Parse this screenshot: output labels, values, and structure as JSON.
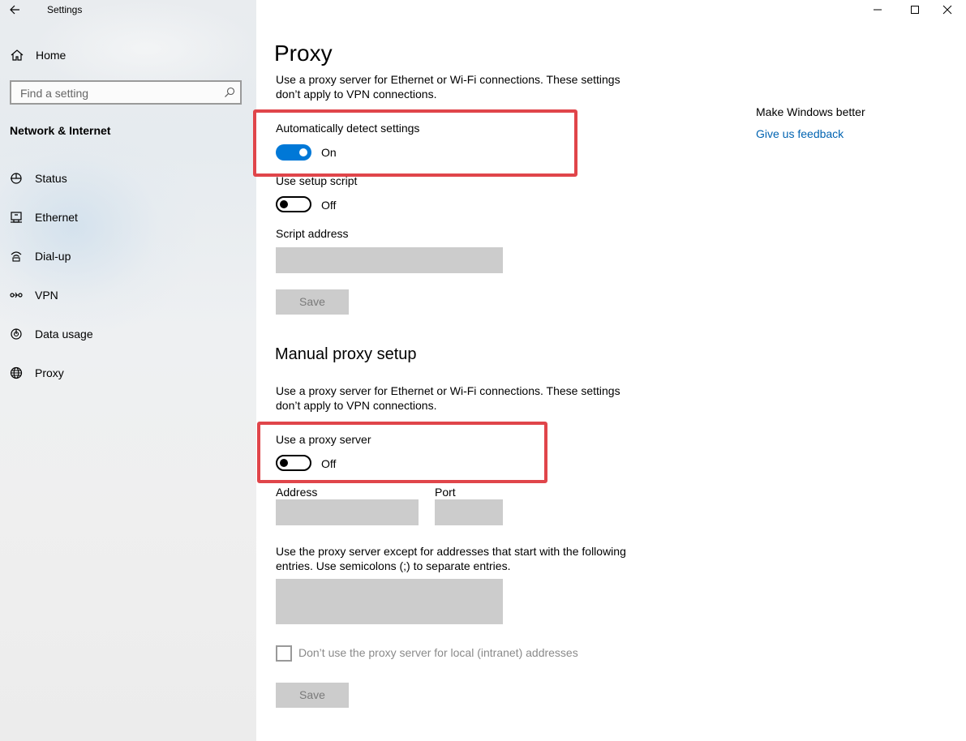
{
  "window": {
    "app_title": "Settings"
  },
  "sidebar": {
    "home_label": "Home",
    "search_placeholder": "Find a setting",
    "section_title": "Network & Internet",
    "items": [
      {
        "label": "Status",
        "icon": "status-icon"
      },
      {
        "label": "Ethernet",
        "icon": "ethernet-icon"
      },
      {
        "label": "Dial-up",
        "icon": "dialup-icon"
      },
      {
        "label": "VPN",
        "icon": "vpn-icon"
      },
      {
        "label": "Data usage",
        "icon": "data-usage-icon"
      },
      {
        "label": "Proxy",
        "icon": "globe-icon"
      }
    ]
  },
  "main": {
    "title": "Proxy",
    "auto_desc": "Use a proxy server for Ethernet or Wi-Fi connections. These settings don’t apply to VPN connections.",
    "auto_detect": {
      "label": "Automatically detect settings",
      "state": "On",
      "on": true
    },
    "setup_script": {
      "label": "Use setup script",
      "state": "Off",
      "on": false
    },
    "script_address_label": "Script address",
    "save_label": "Save",
    "manual_title": "Manual proxy setup",
    "manual_desc": "Use a proxy server for Ethernet or Wi-Fi connections. These settings don’t apply to VPN connections.",
    "use_proxy": {
      "label": "Use a proxy server",
      "state": "Off",
      "on": false
    },
    "address_label": "Address",
    "port_label": "Port",
    "exceptions_desc": "Use the proxy server except for addresses that start with the following entries. Use semicolons (;) to separate entries.",
    "local_checkbox_label": "Don’t use the proxy server for local (intranet) addresses",
    "manual_save_label": "Save"
  },
  "right_panel": {
    "title": "Make Windows better",
    "feedback_link": "Give us feedback"
  },
  "colors": {
    "accent": "#0078d7",
    "highlight": "#e0454a",
    "link": "#0063b1",
    "disabled_field": "#cccccc"
  }
}
